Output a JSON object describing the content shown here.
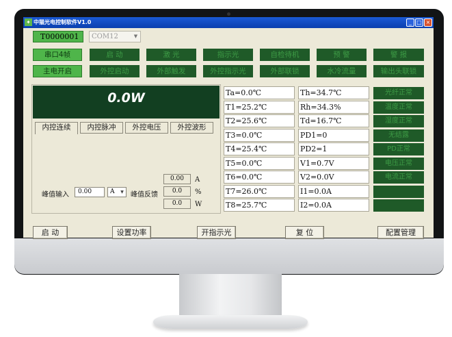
{
  "window": {
    "title": "中猫光电控制软件V1.0"
  },
  "top": {
    "device_id": "T0000001",
    "port": "COM12"
  },
  "row1": [
    "串口4帧",
    "启 动",
    "激 光",
    "指示光",
    "自检待机",
    "预 警",
    "警 报"
  ],
  "row2": [
    "主电开启",
    "外控启动",
    "外部触发",
    "外控指示光",
    "外部联锁",
    "水冷流量",
    "输出头联锁"
  ],
  "power_display": "0.0W",
  "tabs": [
    "内控连续",
    "内控脉冲",
    "外控电压",
    "外控波形"
  ],
  "peak": {
    "input_label": "峰值输入",
    "input_value": "0.00",
    "unit_select": "A",
    "feedback_label": "峰值反馈",
    "feedback": [
      {
        "value": "0.00",
        "unit": "A"
      },
      {
        "value": "0.0",
        "unit": "%"
      },
      {
        "value": "0.0",
        "unit": "W"
      }
    ]
  },
  "readings_left": [
    "Ta=0.0℃",
    "T1=25.2℃",
    "T2=25.6℃",
    "T3=0.0℃",
    "T4=25.4℃",
    "T5=0.0℃",
    "T6=0.0℃",
    "T7=26.0℃",
    "T8=25.7℃"
  ],
  "readings_right": [
    "Th=34.7℃",
    "Rh=34.3%",
    "Td=16.7℃",
    "PD1=0",
    "PD2=1",
    "V1=0.7V",
    "V2=0.0V",
    "I1=0.0A",
    "I2=0.0A"
  ],
  "status": [
    "光纤正常",
    "温度正常",
    "湿度正常",
    "无结露",
    "PD正常",
    "电压正常",
    "电流正常",
    "",
    ""
  ],
  "bottom_buttons": [
    "启 动",
    "设置功率",
    "开指示光",
    "复 位",
    "配置管理"
  ],
  "colors": {
    "indicator_on": "#4fb54a",
    "indicator_off": "#1f5a28",
    "display_bg": "#123f21"
  }
}
